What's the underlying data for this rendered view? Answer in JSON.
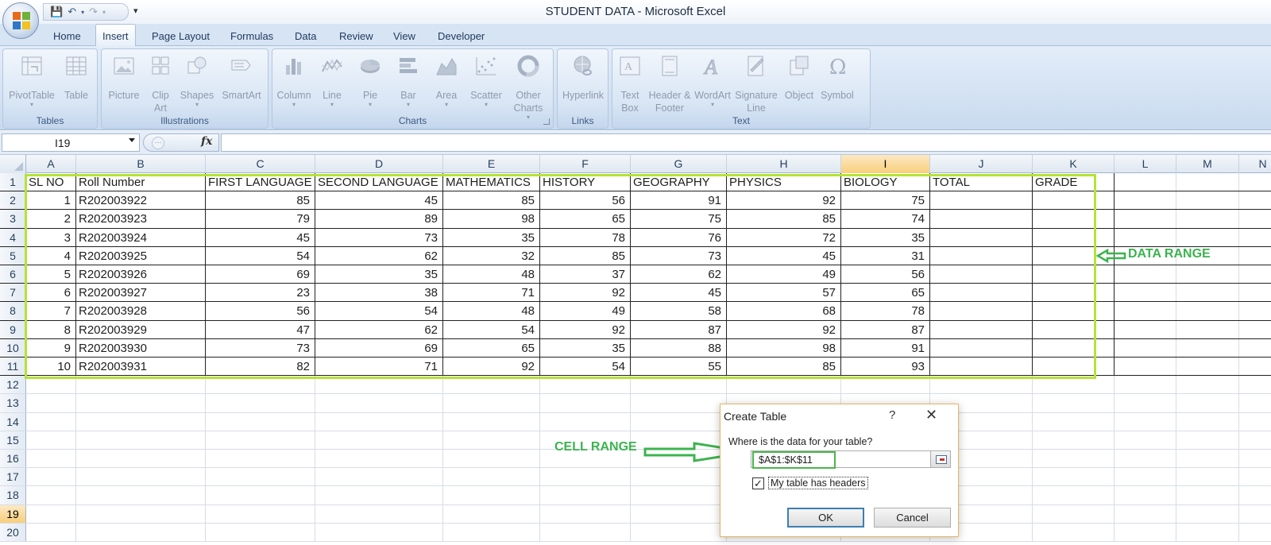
{
  "window": {
    "title": "STUDENT DATA - Microsoft Excel"
  },
  "quick_access": {
    "save_icon": "save-icon",
    "undo_icon": "undo-icon",
    "redo_icon": "redo-icon",
    "customize_icon": "customize-qat-icon"
  },
  "tabs": [
    {
      "label": "Home",
      "active": false
    },
    {
      "label": "Insert",
      "active": true
    },
    {
      "label": "Page Layout",
      "active": false
    },
    {
      "label": "Formulas",
      "active": false
    },
    {
      "label": "Data",
      "active": false
    },
    {
      "label": "Review",
      "active": false
    },
    {
      "label": "View",
      "active": false
    },
    {
      "label": "Developer",
      "active": false
    }
  ],
  "ribbon": {
    "groups": [
      {
        "label": "Tables",
        "buttons": [
          {
            "label": "PivotTable",
            "icon": "pivottable-icon"
          },
          {
            "label": "Table",
            "icon": "table-icon"
          }
        ]
      },
      {
        "label": "Illustrations",
        "buttons": [
          {
            "label": "Picture",
            "icon": "picture-icon"
          },
          {
            "label": "Clip Art",
            "icon": "clip-art-icon"
          },
          {
            "label": "Shapes",
            "icon": "shapes-icon"
          },
          {
            "label": "SmartArt",
            "icon": "smartart-icon"
          }
        ]
      },
      {
        "label": "Charts",
        "buttons": [
          {
            "label": "Column",
            "icon": "column-chart-icon"
          },
          {
            "label": "Line",
            "icon": "line-chart-icon"
          },
          {
            "label": "Pie",
            "icon": "pie-chart-icon"
          },
          {
            "label": "Bar",
            "icon": "bar-chart-icon"
          },
          {
            "label": "Area",
            "icon": "area-chart-icon"
          },
          {
            "label": "Scatter",
            "icon": "scatter-chart-icon"
          },
          {
            "label": "Other Charts",
            "icon": "other-charts-icon"
          }
        ]
      },
      {
        "label": "Links",
        "buttons": [
          {
            "label": "Hyperlink",
            "icon": "hyperlink-icon"
          }
        ]
      },
      {
        "label": "Text",
        "buttons": [
          {
            "label": "Text Box",
            "icon": "text-box-icon"
          },
          {
            "label": "Header & Footer",
            "icon": "header-footer-icon"
          },
          {
            "label": "WordArt",
            "icon": "wordart-icon"
          },
          {
            "label": "Signature Line",
            "icon": "signature-line-icon"
          },
          {
            "label": "Object",
            "icon": "object-icon"
          },
          {
            "label": "Symbol",
            "icon": "symbol-icon"
          }
        ]
      }
    ]
  },
  "formula_bar": {
    "name_box": "I19",
    "fx_label": "fx",
    "formula": ""
  },
  "sheet": {
    "columns": [
      "A",
      "B",
      "C",
      "D",
      "E",
      "F",
      "G",
      "H",
      "I",
      "J",
      "K",
      "L",
      "M",
      "N"
    ],
    "selected_column": "I",
    "selected_row": 19,
    "rows": [
      "1",
      "2",
      "3",
      "4",
      "5",
      "6",
      "7",
      "8",
      "9",
      "10",
      "11",
      "12",
      "13",
      "14",
      "15",
      "16",
      "17",
      "18",
      "19",
      "20"
    ],
    "headers": [
      "SL NO",
      "Roll Number",
      "FIRST LANGUAGE",
      "SECOND LANGUAGE",
      "MATHEMATICS",
      "HISTORY",
      "GEOGRAPHY",
      "PHYSICS",
      "BIOLOGY",
      "TOTAL",
      "GRADE"
    ],
    "data": [
      [
        "1",
        "R202003922",
        "85",
        "45",
        "85",
        "56",
        "91",
        "92",
        "75",
        "",
        ""
      ],
      [
        "2",
        "R202003923",
        "79",
        "89",
        "98",
        "65",
        "75",
        "85",
        "74",
        "",
        ""
      ],
      [
        "3",
        "R202003924",
        "45",
        "73",
        "35",
        "78",
        "76",
        "72",
        "35",
        "",
        ""
      ],
      [
        "4",
        "R202003925",
        "54",
        "62",
        "32",
        "85",
        "73",
        "45",
        "31",
        "",
        ""
      ],
      [
        "5",
        "R202003926",
        "69",
        "35",
        "48",
        "37",
        "62",
        "49",
        "56",
        "",
        ""
      ],
      [
        "6",
        "R202003927",
        "23",
        "38",
        "71",
        "92",
        "45",
        "57",
        "65",
        "",
        ""
      ],
      [
        "7",
        "R202003928",
        "56",
        "54",
        "48",
        "49",
        "58",
        "68",
        "78",
        "",
        ""
      ],
      [
        "8",
        "R202003929",
        "47",
        "62",
        "54",
        "92",
        "87",
        "92",
        "87",
        "",
        ""
      ],
      [
        "9",
        "R202003930",
        "73",
        "69",
        "65",
        "35",
        "88",
        "98",
        "91",
        "",
        ""
      ],
      [
        "10",
        "R202003931",
        "82",
        "71",
        "92",
        "54",
        "55",
        "85",
        "93",
        "",
        ""
      ]
    ]
  },
  "annotations": {
    "data_range_label": "DATA RANGE",
    "cell_range_label": "CELL RANGE",
    "color": "#3cb34f",
    "box_color": "#b5e334"
  },
  "dialog": {
    "title": "Create Table",
    "help": "?",
    "close": "✕",
    "question": "Where is the data for your table?",
    "range": "$A$1:$K$11",
    "checkbox_label": "My table has headers",
    "checkbox_checked": true,
    "ok": "OK",
    "cancel": "Cancel"
  }
}
